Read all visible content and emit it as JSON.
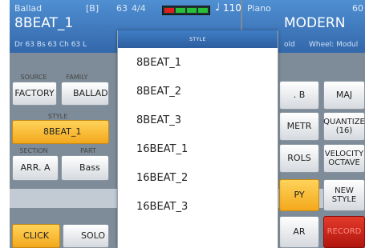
{
  "header": {
    "style_category": "Ballad",
    "bank": "[B]",
    "channel_value": "63",
    "time_signature": "4/4",
    "tempo_note_icon": "quarter-note-icon",
    "tempo": "110",
    "style_name": "8BEAT_1",
    "info_row": "Dr 63  Bs 63  Ch 63  L",
    "voice_category": "Piano",
    "voice_value": "60",
    "voice_name": "MODERN",
    "voice_info_a": "old",
    "voice_info_b": "Wheel: Modul"
  },
  "left_panel": {
    "source_label": "SOURCE",
    "family_label": "FAMILY",
    "source_value": "FACTORY",
    "family_value": "BALLAD",
    "style_label": "STYLE",
    "style_value": "8BEAT_1",
    "section_label": "SECTION",
    "part_label": "PART",
    "section_value": "ARR. A",
    "part_value": "Bass",
    "click_button": "CLICK",
    "solo_button": "SOLO"
  },
  "right_panel": {
    "btn_b": ". B",
    "btn_maj": "MAJ",
    "btn_metr": "METR",
    "btn_quantize": "QUANTIZE\n(16)",
    "btn_rols": "ROLS",
    "btn_velocity": "VELOCITY\nOCTAVE",
    "btn_py": "PY",
    "btn_new_style": "NEW STYLE",
    "btn_ar": "AR",
    "btn_record": "RECORD"
  },
  "popup": {
    "title": "STYLE",
    "items": [
      "8BEAT_1",
      "8BEAT_2",
      "8BEAT_3",
      "16BEAT_1",
      "16BEAT_2",
      "16BEAT_3"
    ]
  },
  "colors": {
    "header_blue": "#3f7dc5",
    "button_orange": "#f3a81c",
    "record_red": "#c0201a",
    "panel_gray": "#7e8c99"
  }
}
